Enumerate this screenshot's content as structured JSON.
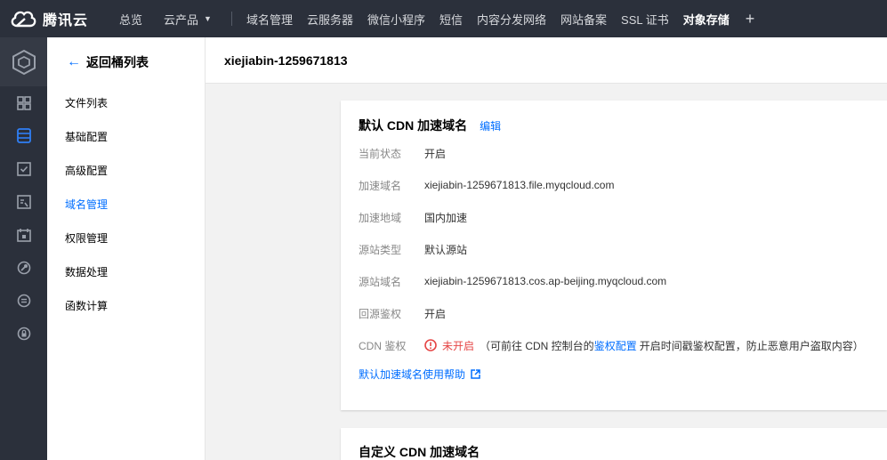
{
  "brand": {
    "name": "腾讯云"
  },
  "topnav": {
    "overview": "总览",
    "products": "云产品",
    "items": [
      "域名管理",
      "云服务器",
      "微信小程序",
      "短信",
      "内容分发网络",
      "网站备案",
      "SSL 证书",
      "对象存储"
    ],
    "active_index": 7,
    "plus": "+"
  },
  "rail": {
    "icons": [
      "cube-logo-icon",
      "dashboard-icon",
      "bucket-icon",
      "checklist-icon",
      "monitor-icon",
      "calendar-icon",
      "tool-icon",
      "list-circle-icon",
      "lock-circle-icon"
    ]
  },
  "sidebar": {
    "back_label": "返回桶列表",
    "items": [
      "文件列表",
      "基础配置",
      "高级配置",
      "域名管理",
      "权限管理",
      "数据处理",
      "函数计算"
    ],
    "active_index": 3
  },
  "header": {
    "bucket_name": "xiejiabin-1259671813"
  },
  "default_cdn": {
    "title": "默认 CDN 加速域名",
    "edit_label": "编辑",
    "rows": [
      {
        "label": "当前状态",
        "value": "开启"
      },
      {
        "label": "加速域名",
        "value": "xiejiabin-1259671813.file.myqcloud.com"
      },
      {
        "label": "加速地域",
        "value": "国内加速"
      },
      {
        "label": "源站类型",
        "value": "默认源站"
      },
      {
        "label": "源站域名",
        "value": "xiejiabin-1259671813.cos.ap-beijing.myqcloud.com"
      },
      {
        "label": "回源鉴权",
        "value": "开启"
      }
    ],
    "cdn_auth": {
      "label": "CDN 鉴权",
      "status": "未开启",
      "note_prefix": "（可前往 CDN 控制台的",
      "link": "鉴权配置",
      "note_suffix": "开启时间戳鉴权配置，防止恶意用户盗取内容）"
    },
    "help_link": "默认加速域名使用帮助"
  },
  "custom_cdn": {
    "title": "自定义 CDN 加速域名"
  },
  "colors": {
    "accent": "#006eff",
    "warning": "#e54545",
    "topbar": "#2b303b"
  }
}
